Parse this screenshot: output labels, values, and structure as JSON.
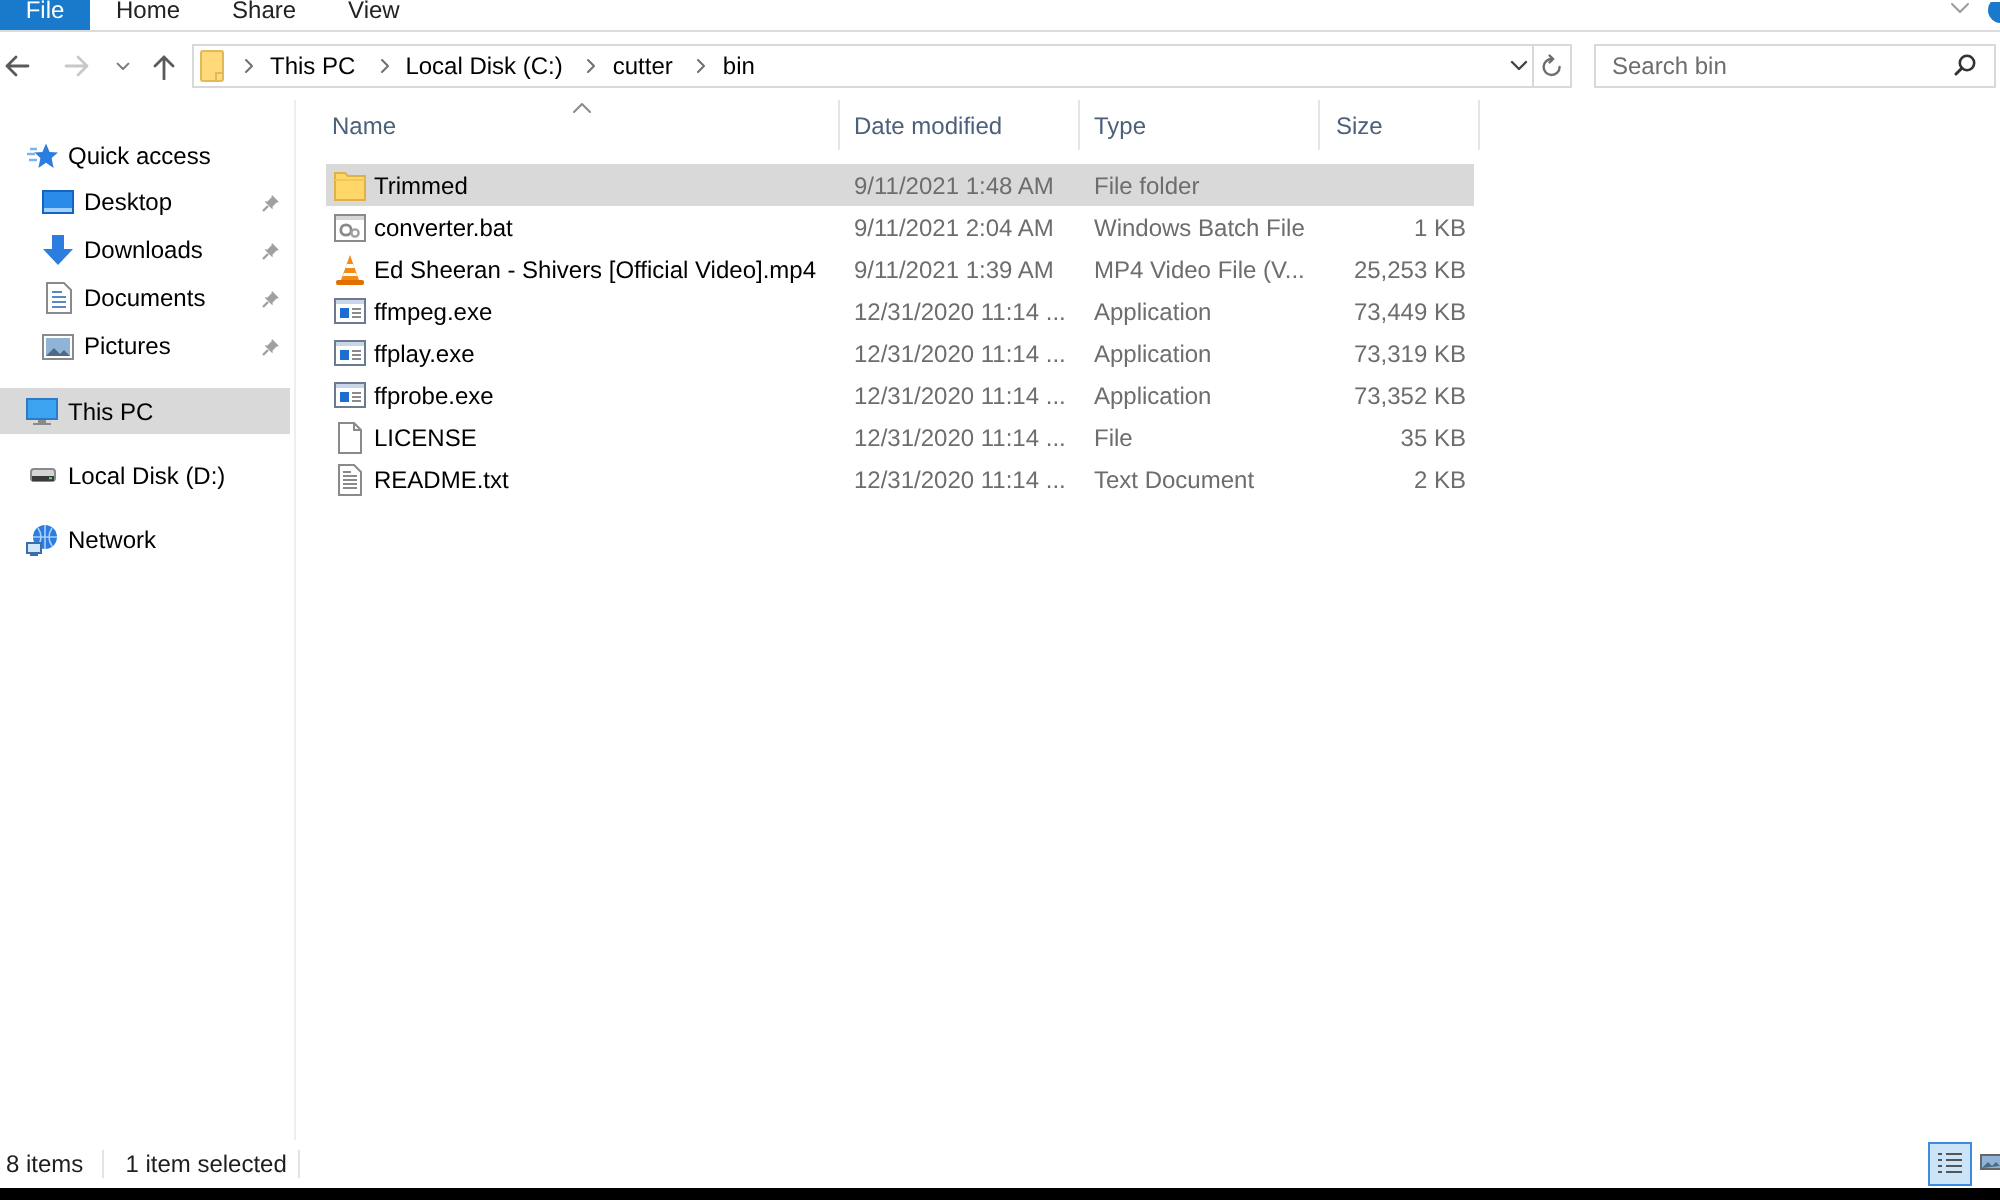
{
  "ribbon": {
    "tabs": [
      {
        "label": "File",
        "kind": "file"
      },
      {
        "label": "Home",
        "kind": "tab"
      },
      {
        "label": "Share",
        "kind": "tab"
      },
      {
        "label": "View",
        "kind": "tab"
      }
    ]
  },
  "address_bar": {
    "path": [
      "This PC",
      "Local Disk (C:)",
      "cutter",
      "bin"
    ]
  },
  "search": {
    "placeholder": "Search bin"
  },
  "sidebar": {
    "items": [
      {
        "label": "Quick access",
        "kind": "quick_access",
        "selected": false,
        "children": [
          {
            "label": "Desktop",
            "kind": "desktop",
            "selected": false,
            "pinned": true
          },
          {
            "label": "Downloads",
            "kind": "downloads",
            "selected": false,
            "pinned": true
          },
          {
            "label": "Documents",
            "kind": "documents",
            "selected": false,
            "pinned": true
          },
          {
            "label": "Pictures",
            "kind": "pictures",
            "selected": false,
            "pinned": true
          }
        ]
      },
      {
        "label": "This PC",
        "kind": "pc",
        "selected": true
      },
      {
        "label": "Local Disk (D:)",
        "kind": "drive",
        "selected": false
      },
      {
        "label": "Network",
        "kind": "network",
        "selected": false
      }
    ]
  },
  "table": {
    "columns": [
      {
        "label": "Name",
        "sorted": true
      },
      {
        "label": "Date modified",
        "sorted": false
      },
      {
        "label": "Type",
        "sorted": false
      },
      {
        "label": "Size",
        "sorted": false
      }
    ],
    "rows": [
      {
        "name": "Trimmed",
        "kind": "folder",
        "date_modified": "9/11/2021 1:48 AM",
        "type": "File folder",
        "selected": true
      },
      {
        "name": "converter.bat",
        "kind": "batch",
        "date_modified": "9/11/2021 2:04 AM",
        "type": "Windows Batch File",
        "size": "1 KB",
        "selected": false
      },
      {
        "name": "Ed Sheeran - Shivers [Official Video].mp4",
        "kind": "video",
        "date_modified": "9/11/2021 1:39 AM",
        "type": "MP4 Video File (V...",
        "size": "25,253 KB",
        "selected": false
      },
      {
        "name": "ffmpeg.exe",
        "kind": "application",
        "date_modified": "12/31/2020 11:14 ...",
        "type": "Application",
        "size": "73,449 KB",
        "selected": false
      },
      {
        "name": "ffplay.exe",
        "kind": "application",
        "date_modified": "12/31/2020 11:14 ...",
        "type": "Application",
        "size": "73,319 KB",
        "selected": false
      },
      {
        "name": "ffprobe.exe",
        "kind": "application",
        "date_modified": "12/31/2020 11:14 ...",
        "type": "Application",
        "size": "73,352 KB",
        "selected": false
      },
      {
        "name": "LICENSE",
        "kind": "file",
        "date_modified": "12/31/2020 11:14 ...",
        "type": "File",
        "size": "35 KB",
        "selected": false
      },
      {
        "name": "README.txt",
        "kind": "text",
        "date_modified": "12/31/2020 11:14 ...",
        "type": "Text Document",
        "size": "2 KB",
        "selected": false
      }
    ]
  },
  "status_bar": {
    "item_count": "8 items",
    "selection": "1 item selected",
    "views": [
      {
        "kind": "details",
        "selected": true
      },
      {
        "kind": "large_icons",
        "selected": false
      }
    ]
  }
}
